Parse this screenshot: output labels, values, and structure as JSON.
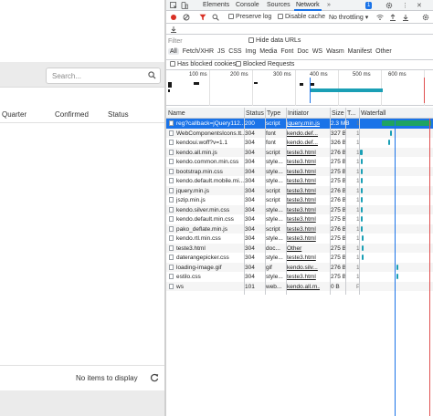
{
  "app": {
    "search_placeholder": "Search...",
    "columns": [
      "Quarter",
      "Confirmed",
      "Status"
    ],
    "empty_message": "No items to display"
  },
  "devtools": {
    "tabs": [
      "Elements",
      "Console",
      "Sources",
      "Network"
    ],
    "active_tab": "Network",
    "badge": "1",
    "toolbar": {
      "preserve_log": "Preserve log",
      "disable_cache": "Disable cache",
      "throttling": "No throttling"
    },
    "filter": {
      "placeholder": "Filter",
      "hide_data_urls": "Hide data URLs",
      "types": [
        "All",
        "Fetch/XHR",
        "JS",
        "CSS",
        "Img",
        "Media",
        "Font",
        "Doc",
        "WS",
        "Wasm",
        "Manifest",
        "Other"
      ],
      "has_blocked_cookies": "Has blocked cookies",
      "blocked_requests": "Blocked Requests"
    },
    "overview_ticks": [
      "100 ms",
      "200 ms",
      "300 ms",
      "400 ms",
      "500 ms",
      "600 ms"
    ],
    "table_headers": {
      "name": "Name",
      "status": "Status",
      "type": "Type",
      "initiator": "Initiator",
      "size": "Size",
      "time": "T...",
      "waterfall": "Waterfall"
    },
    "requests": [
      {
        "name": "reg?callback=jQuery112...",
        "status": "200",
        "type": "script",
        "initiator": "jquery.min.js...",
        "size": "2.3 MB",
        "time": "1"
      },
      {
        "name": "WebComponentsIcons.tt...",
        "status": "304",
        "type": "font",
        "initiator": "kendo.def...",
        "size": "327 B",
        "time": "1"
      },
      {
        "name": "kendoui.woff?v=1.1",
        "status": "304",
        "type": "font",
        "initiator": "kendo.def...",
        "size": "326 B",
        "time": "1"
      },
      {
        "name": "kendo.all.min.js",
        "status": "304",
        "type": "script",
        "initiator": "teste3.html",
        "size": "276 B",
        "time": "1"
      },
      {
        "name": "kendo.common.min.css",
        "status": "304",
        "type": "style...",
        "initiator": "teste3.html",
        "size": "275 B",
        "time": "1"
      },
      {
        "name": "bootstrap.min.css",
        "status": "304",
        "type": "style...",
        "initiator": "teste3.html",
        "size": "275 B",
        "time": "1"
      },
      {
        "name": "kendo.default.mobile.mi...",
        "status": "304",
        "type": "style...",
        "initiator": "teste3.html",
        "size": "275 B",
        "time": "1"
      },
      {
        "name": "jquery.min.js",
        "status": "304",
        "type": "script",
        "initiator": "teste3.html",
        "size": "276 B",
        "time": "1"
      },
      {
        "name": "jszip.min.js",
        "status": "304",
        "type": "script",
        "initiator": "teste3.html",
        "size": "276 B",
        "time": "1"
      },
      {
        "name": "kendo.silver.min.css",
        "status": "304",
        "type": "style...",
        "initiator": "teste3.html",
        "size": "275 B",
        "time": "1"
      },
      {
        "name": "kendo.default.min.css",
        "status": "304",
        "type": "style...",
        "initiator": "teste3.html",
        "size": "275 B",
        "time": "1"
      },
      {
        "name": "pako_deflate.min.js",
        "status": "304",
        "type": "script",
        "initiator": "teste3.html",
        "size": "276 B",
        "time": "1"
      },
      {
        "name": "kendo.rtl.min.css",
        "status": "304",
        "type": "style...",
        "initiator": "teste3.html",
        "size": "275 B",
        "time": "1"
      },
      {
        "name": "teste3.html",
        "status": "304",
        "type": "doc...",
        "initiator": "Other",
        "size": "275 B",
        "time": "1"
      },
      {
        "name": "daterangepicker.css",
        "status": "304",
        "type": "style...",
        "initiator": "teste3.html",
        "size": "275 B",
        "time": "1"
      },
      {
        "name": "loading-image.gif",
        "status": "304",
        "type": "gif",
        "initiator": "kendo.silv...",
        "size": "276 B",
        "time": "1"
      },
      {
        "name": "estilo.css",
        "status": "304",
        "type": "style...",
        "initiator": "teste3.html",
        "size": "275 B",
        "time": "1"
      },
      {
        "name": "ws",
        "status": "101",
        "type": "web...",
        "initiator": "kendo.all.m...",
        "size": "0 B",
        "time": "P"
      }
    ]
  }
}
